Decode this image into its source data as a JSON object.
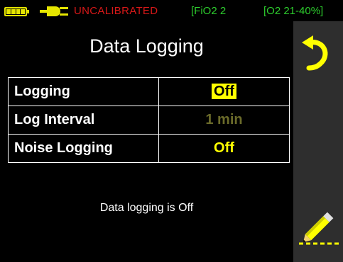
{
  "status": {
    "calibration": "UNCALIBRATED",
    "fio2_mode": "[FiO2 2",
    "o2_range": "[O2 21-40%]",
    "battery_icon": "battery-icon",
    "power_icon": "plug-icon",
    "colors": {
      "warning": "#d61818",
      "ok": "#2dcc2d",
      "accent": "#ffff00"
    }
  },
  "screen": {
    "title": "Data Logging",
    "message": "Data logging is Off"
  },
  "settings": [
    {
      "label": "Logging",
      "value": "Off",
      "state": "selected"
    },
    {
      "label": "Log Interval",
      "value": "1 min",
      "state": "disabled"
    },
    {
      "label": "Noise Logging",
      "value": "Off",
      "state": "normal"
    }
  ],
  "side_panel": {
    "back_icon": "back-arrow-icon",
    "edit_icon": "pencil-icon"
  }
}
